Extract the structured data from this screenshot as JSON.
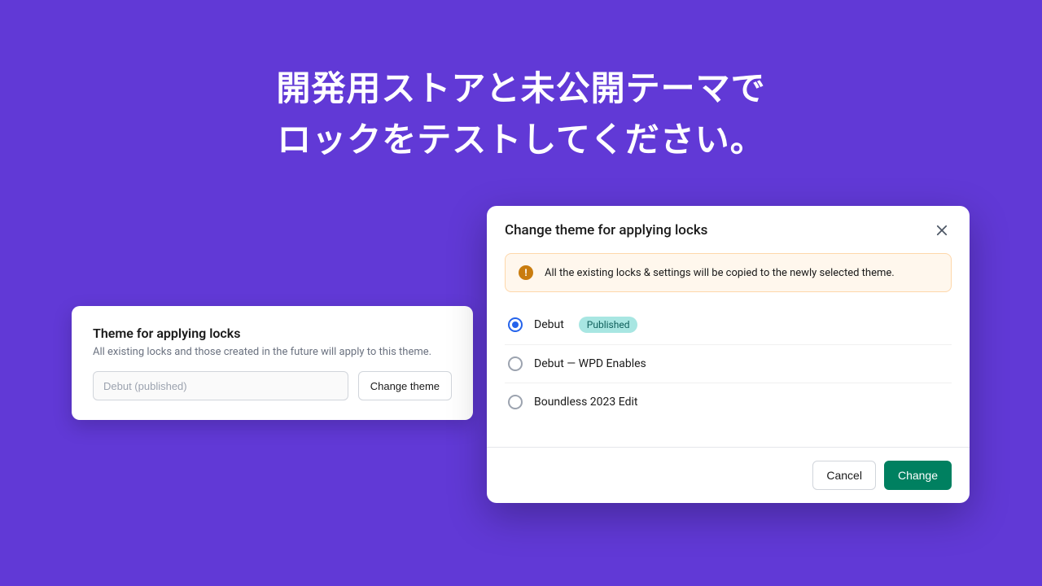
{
  "headline": {
    "line1": "開発用ストアと未公開テーマで",
    "line2": "ロックをテストしてください。"
  },
  "card": {
    "title": "Theme for applying locks",
    "description": "All existing locks and those created in the future will apply to this theme.",
    "input_value": "Debut (published)",
    "change_button": "Change theme"
  },
  "modal": {
    "title": "Change theme for applying locks",
    "banner": "All the existing locks & settings will be copied to the newly selected theme.",
    "themes": [
      {
        "label": "Debut",
        "badge": "Published",
        "selected": true
      },
      {
        "label": "Debut — WPD Enables",
        "badge": null,
        "selected": false
      },
      {
        "label": "Boundless 2023 Edit",
        "badge": null,
        "selected": false
      }
    ],
    "cancel_button": "Cancel",
    "change_button": "Change"
  }
}
